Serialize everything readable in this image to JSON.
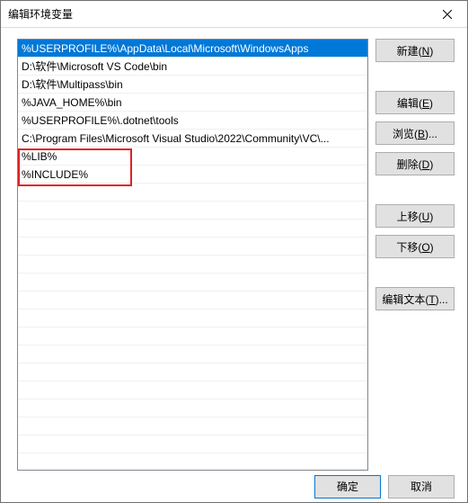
{
  "window": {
    "title": "编辑环境变量"
  },
  "list": {
    "items": [
      "%USERPROFILE%\\AppData\\Local\\Microsoft\\WindowsApps",
      "D:\\软件\\Microsoft VS Code\\bin",
      "D:\\软件\\Multipass\\bin",
      "%JAVA_HOME%\\bin",
      "%USERPROFILE%\\.dotnet\\tools",
      "C:\\Program Files\\Microsoft Visual Studio\\2022\\Community\\VC\\...",
      "%LIB%",
      "%INCLUDE%"
    ],
    "selected_index": 0
  },
  "buttons": {
    "new": "新建(N)",
    "edit": "编辑(E)",
    "browse": "浏览(B)...",
    "delete": "删除(D)",
    "move_up": "上移(U)",
    "move_down": "下移(O)",
    "edit_text": "编辑文本(T)...",
    "ok": "确定",
    "cancel": "取消"
  },
  "mnemonics": {
    "new": "N",
    "edit": "E",
    "browse": "B",
    "delete": "D",
    "move_up": "U",
    "move_down": "O",
    "edit_text": "T"
  }
}
